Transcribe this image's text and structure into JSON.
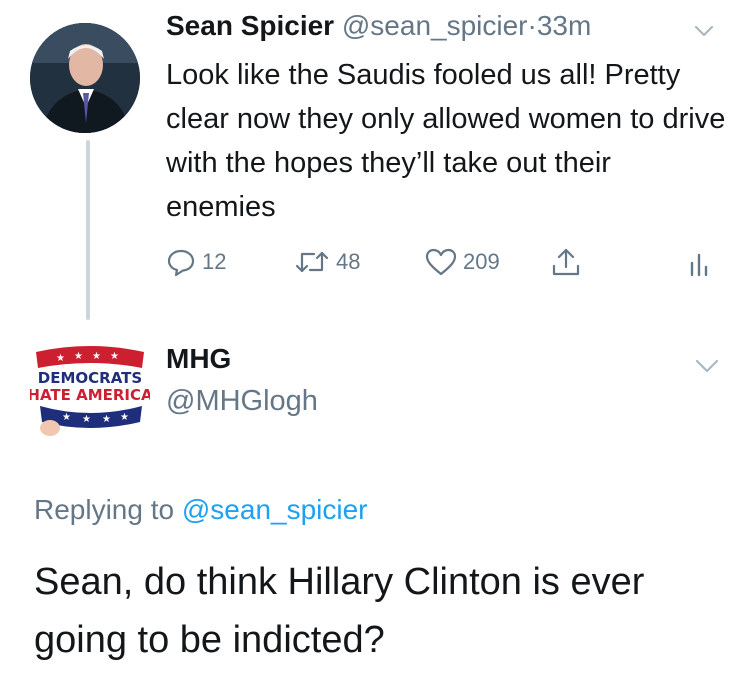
{
  "tweet": {
    "author_name": "Sean Spicier",
    "author_handle": "@sean_spicier",
    "separator": "·",
    "time": "33m",
    "text": "Look like the Saudis fooled us all! Pretty clear now they only allowed women to drive with the hopes they’ll take out their enemies",
    "actions": {
      "replies": "12",
      "retweets": "48",
      "likes": "209"
    },
    "icons": [
      "reply-icon",
      "retweet-icon",
      "like-icon",
      "share-icon",
      "analytics-icon"
    ]
  },
  "reply": {
    "author_name": "MHG",
    "author_handle": "@MHGlogh",
    "avatar_text_top": "DEMOCRATS",
    "avatar_text_bottom": "HATE AMERICA",
    "replying_prefix": "Replying to",
    "replying_to": "@sean_spicier",
    "text": "Sean, do think Hillary Clinton is ever going to be indicted?"
  },
  "colors": {
    "secondary_text": "#657786",
    "link": "#1da1f2",
    "thread_line": "#ccd6dd"
  }
}
